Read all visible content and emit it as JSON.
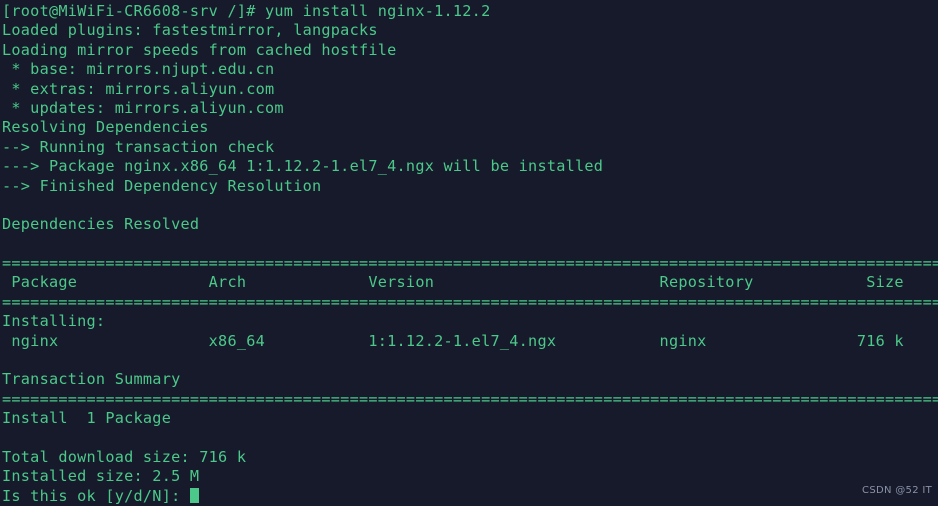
{
  "terminal": {
    "background_color": "#161a2b",
    "text_color": "#4cc98a",
    "watermark": "CSDN @52 IT",
    "prompt": "[root@MiWiFi-CR6608-srv /]#",
    "command": "yum install nginx-1.12.2",
    "cursor": "block-cursor",
    "lines": [
      "[root@MiWiFi-CR6608-srv /]# yum install nginx-1.12.2",
      "Loaded plugins: fastestmirror, langpacks",
      "Loading mirror speeds from cached hostfile",
      " * base: mirrors.njupt.edu.cn",
      " * extras: mirrors.aliyun.com",
      " * updates: mirrors.aliyun.com",
      "Resolving Dependencies",
      "--> Running transaction check",
      "---> Package nginx.x86_64 1:1.12.2-1.el7_4.ngx will be installed",
      "--> Finished Dependency Resolution",
      "",
      "Dependencies Resolved",
      "",
      "=====================================================================================================",
      " Package              Arch             Version                        Repository            Size",
      "=====================================================================================================",
      "Installing:",
      " nginx                x86_64           1:1.12.2-1.el7_4.ngx           nginx                716 k",
      "",
      "Transaction Summary",
      "=====================================================================================================",
      "Install  1 Package",
      "",
      "Total download size: 716 k",
      "Installed size: 2.5 M",
      "Is this ok [y/d/N]: "
    ],
    "table": {
      "headers": [
        "Package",
        "Arch",
        "Version",
        "Repository",
        "Size"
      ],
      "section_label": "Installing:",
      "rows": [
        {
          "package": "nginx",
          "arch": "x86_64",
          "version": "1:1.12.2-1.el7_4.ngx",
          "repository": "nginx",
          "size": "716 k"
        }
      ]
    },
    "summary": {
      "heading": "Transaction Summary",
      "install_line": "Install  1 Package",
      "total_download_size": "Total download size: 716 k",
      "installed_size": "Installed size: 2.5 M",
      "prompt_question": "Is this ok [y/d/N]: "
    }
  }
}
